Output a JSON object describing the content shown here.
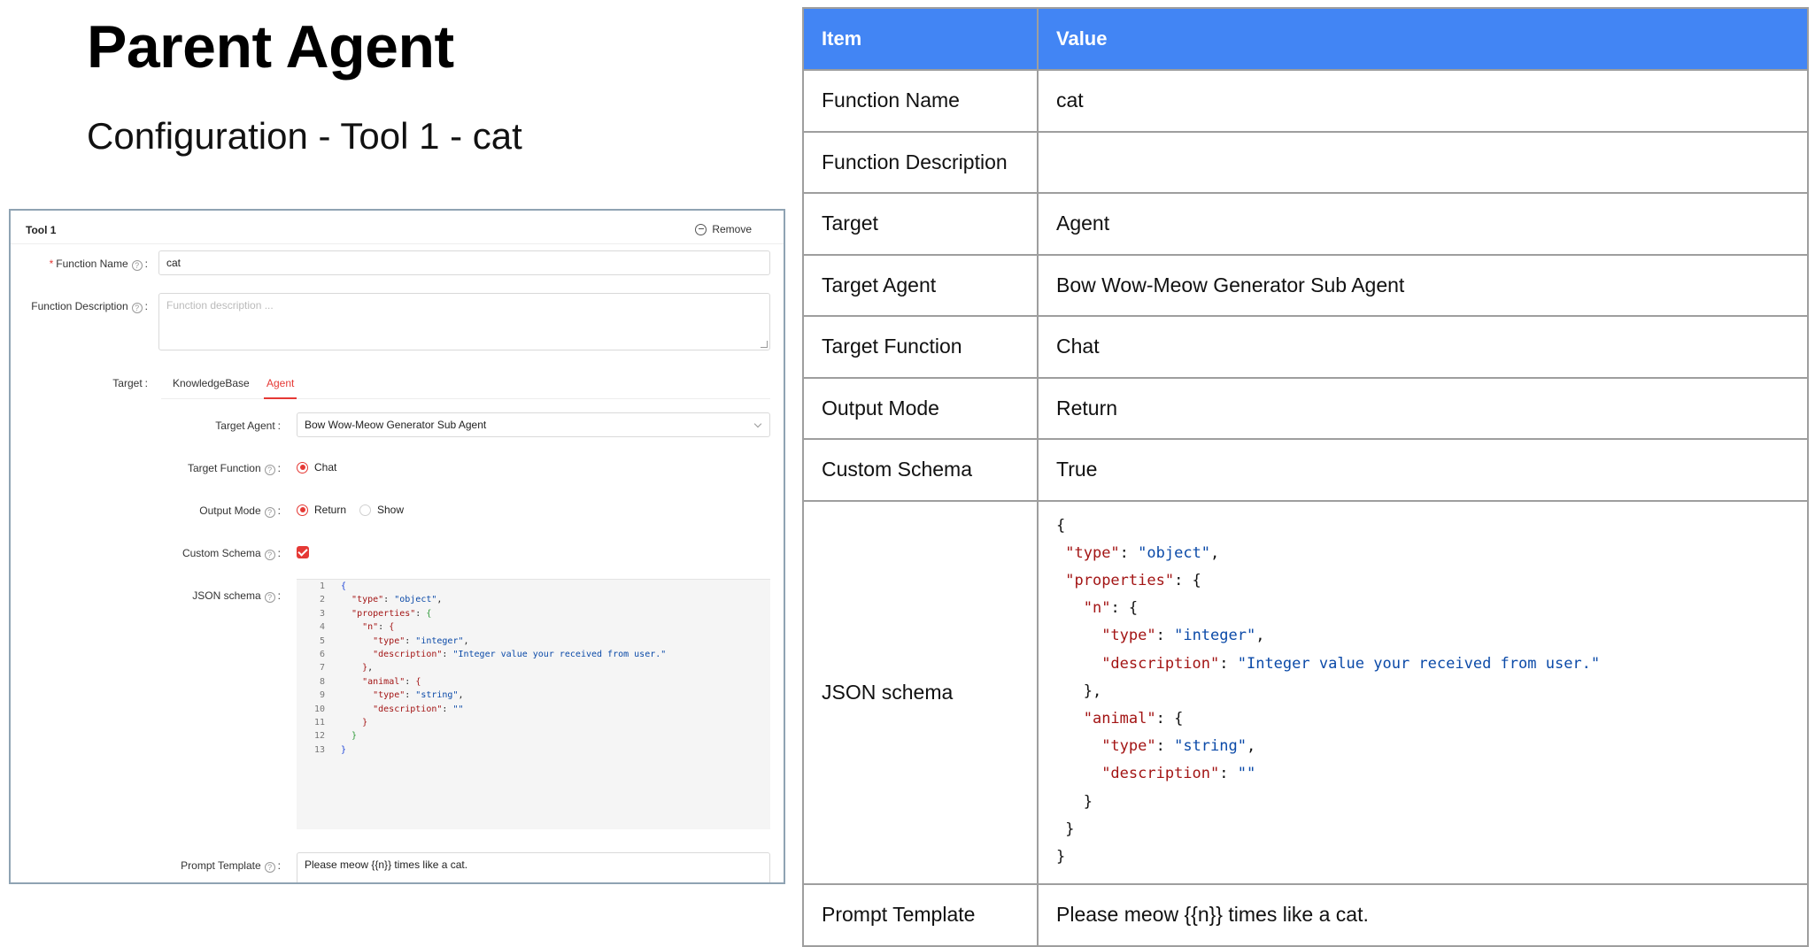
{
  "slide": {
    "title": "Parent Agent",
    "subtitle": "Configuration - Tool 1 - cat"
  },
  "form": {
    "tool_title": "Tool 1",
    "remove_label": "Remove",
    "function_name_label": "Function Name",
    "function_name_value": "cat",
    "function_description_label": "Function Description",
    "function_description_placeholder": "Function description ...",
    "target_label": "Target",
    "target_tabs": [
      "KnowledgeBase",
      "Agent"
    ],
    "target_tab_selected": "Agent",
    "target_agent_label": "Target Agent",
    "target_agent_value": "Bow Wow-Meow Generator Sub Agent",
    "target_function_label": "Target Function",
    "target_function_option": "Chat",
    "output_mode_label": "Output Mode",
    "output_mode_options": [
      "Return",
      "Show"
    ],
    "output_mode_selected": "Return",
    "custom_schema_label": "Custom Schema",
    "custom_schema_checked": true,
    "json_schema_label": "JSON schema",
    "json_schema_line_numbers": [
      "1",
      "2",
      "3",
      "4",
      "5",
      "6",
      "7",
      "8",
      "9",
      "10",
      "11",
      "12",
      "13"
    ],
    "prompt_template_label": "Prompt Template",
    "prompt_template_value": "Please meow {{n}} times like a cat."
  },
  "json_schema": {
    "type_key": "\"type\"",
    "type_value": "\"object\"",
    "properties_key": "\"properties\"",
    "n_key": "\"n\"",
    "n_type_value": "\"integer\"",
    "description_key": "\"description\"",
    "n_description_value": "\"Integer value your received from user.\"",
    "animal_key": "\"animal\"",
    "animal_type_value": "\"string\"",
    "animal_description_value": "\"\""
  },
  "table": {
    "header": {
      "item": "Item",
      "value": "Value"
    },
    "rows": [
      {
        "item": "Function Name",
        "value": "cat"
      },
      {
        "item": "Function Description",
        "value": ""
      },
      {
        "item": "Target",
        "value": "Agent"
      },
      {
        "item": "Target Agent",
        "value": "Bow Wow-Meow Generator Sub Agent"
      },
      {
        "item": "Target Function",
        "value": "Chat"
      },
      {
        "item": "Output Mode",
        "value": "Return"
      },
      {
        "item": "Custom Schema",
        "value": "True"
      },
      {
        "item": "JSON schema",
        "value": ""
      },
      {
        "item": "Prompt Template",
        "value": "Please meow {{n}} times like a cat."
      }
    ]
  },
  "colors": {
    "accent_red": "#e53935",
    "table_header_blue": "#4285f4",
    "json_key": "#a31515",
    "json_string": "#0b4aa8"
  }
}
